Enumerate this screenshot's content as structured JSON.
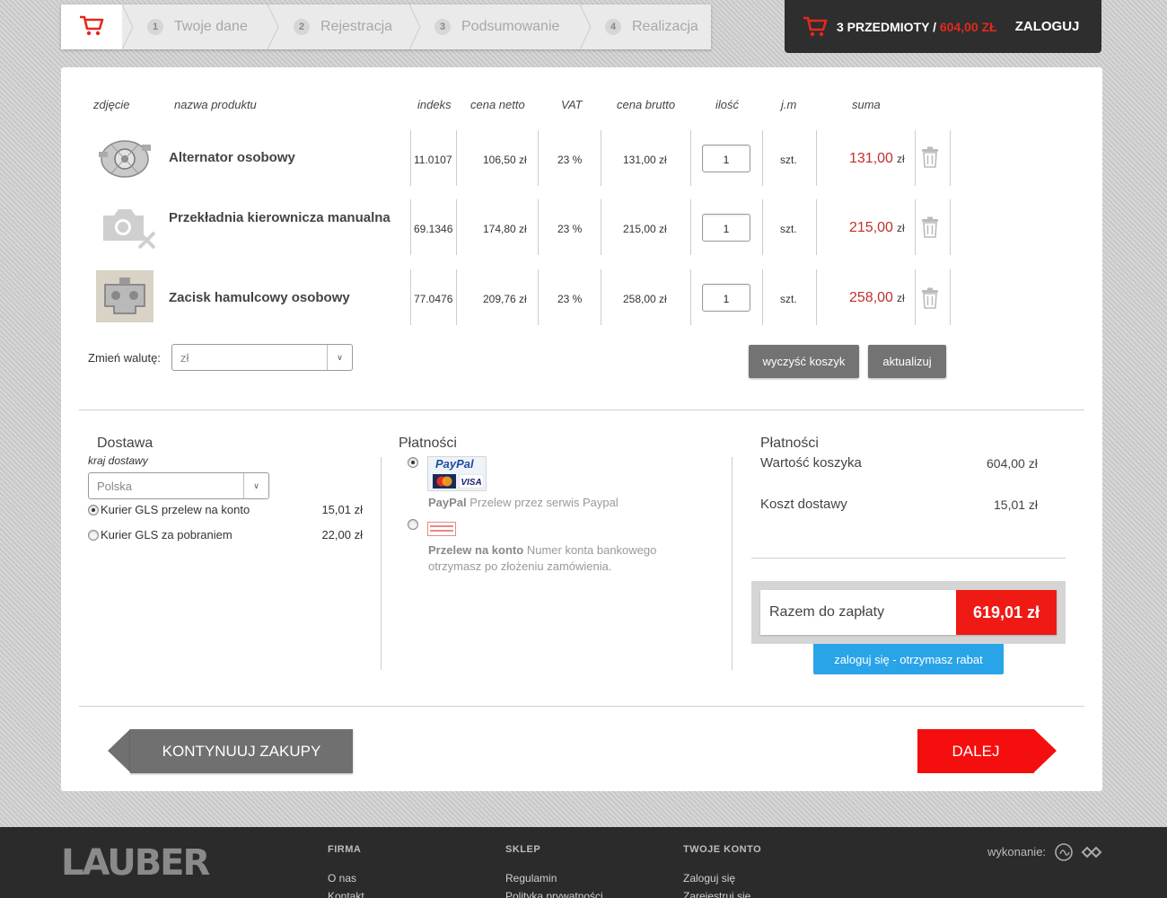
{
  "steps": [
    {
      "num": "1",
      "label": "Twoje dane"
    },
    {
      "num": "2",
      "label": "Rejestracja"
    },
    {
      "num": "3",
      "label": "Podsumowanie"
    },
    {
      "num": "4",
      "label": "Realizacja"
    }
  ],
  "minicart": {
    "items": "3 PRZEDMIOTY /",
    "amount": "604,00 ZŁ",
    "login": "ZALOGUJ"
  },
  "table": {
    "headers": {
      "photo": "zdjęcie",
      "name": "nazwa produktu",
      "index": "indeks",
      "net": "cena netto",
      "vat": "VAT",
      "gross": "cena brutto",
      "qty": "ilość",
      "unit": "j.m",
      "sum": "suma"
    },
    "rows": [
      {
        "name": "Alternator osobowy",
        "index": "11.0107",
        "net": "106,50 zł",
        "vat": "23 %",
        "gross": "131,00 zł",
        "qty": "1",
        "unit": "szt.",
        "sum": "131,00",
        "currency": "zł"
      },
      {
        "name": "Przekładnia kierownicza manualna",
        "index": "69.1346",
        "net": "174,80 zł",
        "vat": "23 %",
        "gross": "215,00 zł",
        "qty": "1",
        "unit": "szt.",
        "sum": "215,00",
        "currency": "zł"
      },
      {
        "name": "Zacisk hamulcowy osobowy",
        "index": "77.0476",
        "net": "209,76 zł",
        "vat": "23 %",
        "gross": "258,00 zł",
        "qty": "1",
        "unit": "szt.",
        "sum": "258,00",
        "currency": "zł"
      }
    ]
  },
  "currency": {
    "label": "Zmień walutę:",
    "selected": "zł"
  },
  "buttons": {
    "clear": "wyczyść koszyk",
    "update": "aktualizuj",
    "back": "KONTYNUUJ ZAKUPY",
    "next": "DALEJ",
    "login_discount": "zaloguj się - otrzymasz rabat"
  },
  "delivery": {
    "title": "Dostawa",
    "country_label": "kraj dostawy",
    "country": "Polska",
    "options": [
      {
        "label": "Kurier GLS przelew na konto",
        "price": "15,01 zł",
        "selected": true
      },
      {
        "label": "Kurier GLS za pobraniem",
        "price": "22,00 zł",
        "selected": false
      }
    ]
  },
  "payment": {
    "title": "Płatności",
    "paypal_logo": "PayPal",
    "options": [
      {
        "name": "PayPal",
        "desc": "Przelew przez serwis Paypal",
        "selected": true
      },
      {
        "name": "Przelew na konto",
        "desc": "Numer konta bankowego otrzymasz po złożeniu zamówienia.",
        "selected": false
      }
    ]
  },
  "summary": {
    "title": "Płatności",
    "cart_value_label": "Wartość koszyka",
    "cart_value": "604,00 zł",
    "shipping_label": "Koszt dostawy",
    "shipping": "15,01 zł",
    "total_label": "Razem do zapłaty",
    "total": "619,01 zł"
  },
  "footer": {
    "logo": "LAUBER",
    "columns": [
      {
        "title": "FIRMA",
        "links": [
          "O nas",
          "Kontakt"
        ]
      },
      {
        "title": "SKLEP",
        "links": [
          "Regulamin",
          "Polityka prywatności"
        ]
      },
      {
        "title": "TWOJE KONTO",
        "links": [
          "Zaloguj się",
          "Zarejestruj się"
        ]
      }
    ],
    "credit": "wykonanie:"
  },
  "colors": {
    "accent_red": "#f01a15",
    "price_red": "#c0302b",
    "blue": "#2aa4e8",
    "dark": "#2b2b2b"
  }
}
